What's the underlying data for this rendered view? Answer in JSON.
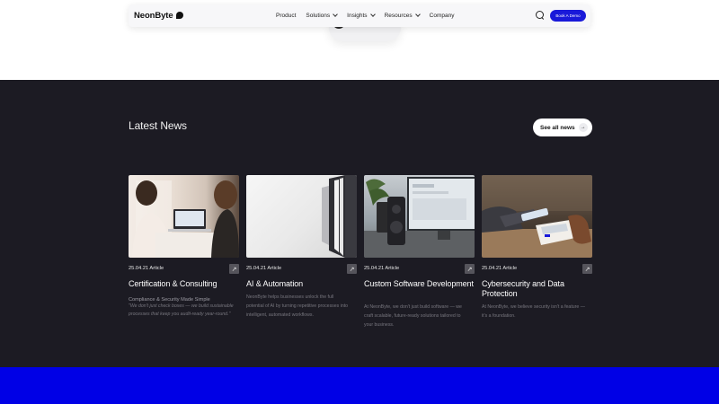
{
  "nav": {
    "logo": "NeonByte",
    "links": [
      {
        "label": "Product",
        "dropdown": false
      },
      {
        "label": "Solutions",
        "dropdown": true
      },
      {
        "label": "Insights",
        "dropdown": true
      },
      {
        "label": "Resources",
        "dropdown": true
      },
      {
        "label": "Company",
        "dropdown": false
      }
    ],
    "cta": "Book A Demo"
  },
  "news": {
    "title": "Latest News",
    "see_all": "See all news",
    "cards": [
      {
        "meta": "25.04.21 Article",
        "title": "Certification & Consulting",
        "subtitle": "Compliance & Security Made Simple",
        "desc": "\"We don't just check boxes — we build sustainable processes that keep you audit-ready year-round.\""
      },
      {
        "meta": "25.04.21 Article",
        "title": "AI & Automation",
        "desc": "NeonByte helps businesses unlock the full potential of AI by turning repetitive processes into intelligent, automated workflows."
      },
      {
        "meta": "25.04.21 Article",
        "title": "Custom Software Development",
        "desc": "At NeonByte, we don't just build software — we craft scalable, future-ready solutions tailored to your business."
      },
      {
        "meta": "25.04.21 Article",
        "title": "Cybersecurity and Data Protection",
        "desc": "At NeonByte, we believe security isn't a feature — it's a foundation."
      }
    ]
  },
  "colors": {
    "dark_bg": "#1c1b23",
    "accent_blue": "#0000e6",
    "cta_blue": "#1a1ad9"
  }
}
